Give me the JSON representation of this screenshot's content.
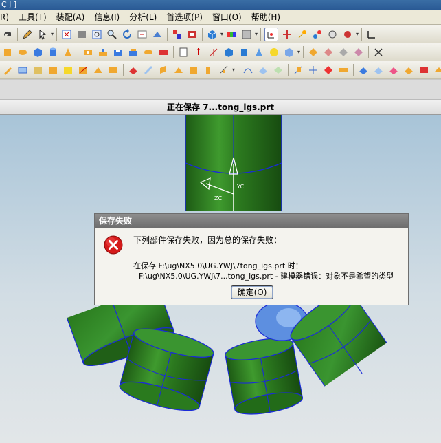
{
  "window": {
    "title_fragment": "Ç J ]"
  },
  "menubar": {
    "items": [
      {
        "label": "R)"
      },
      {
        "label": "工具(T)"
      },
      {
        "label": "装配(A)"
      },
      {
        "label": "信息(I)"
      },
      {
        "label": "分析(L)"
      },
      {
        "label": "首选项(P)"
      },
      {
        "label": "窗口(O)"
      },
      {
        "label": "帮助(H)"
      }
    ]
  },
  "status": {
    "text": "正在保存 7...tong_igs.prt"
  },
  "viewport": {
    "axis_labels": {
      "y": "YC",
      "z": "ZC"
    },
    "colors": {
      "cylinder": "#2f7d22",
      "edge": "#1a2bd8",
      "sky_top": "#a8c4d8",
      "sky_bottom": "#e2e6e8"
    }
  },
  "dialog": {
    "title": "保存失败",
    "message": "下列部件保存失败，因为总的保存失败：",
    "detail_line1": "在保存 F:\\ug\\NX5.0\\UG.YWJ\\7tong_igs.prt 时：",
    "detail_line2": "F:\\ug\\NX5.0\\UG.YWJ\\7...tong_igs.prt - 建模器错误：对象不是希望的类型",
    "ok_label": "确定(O)",
    "icon": "error-icon"
  }
}
